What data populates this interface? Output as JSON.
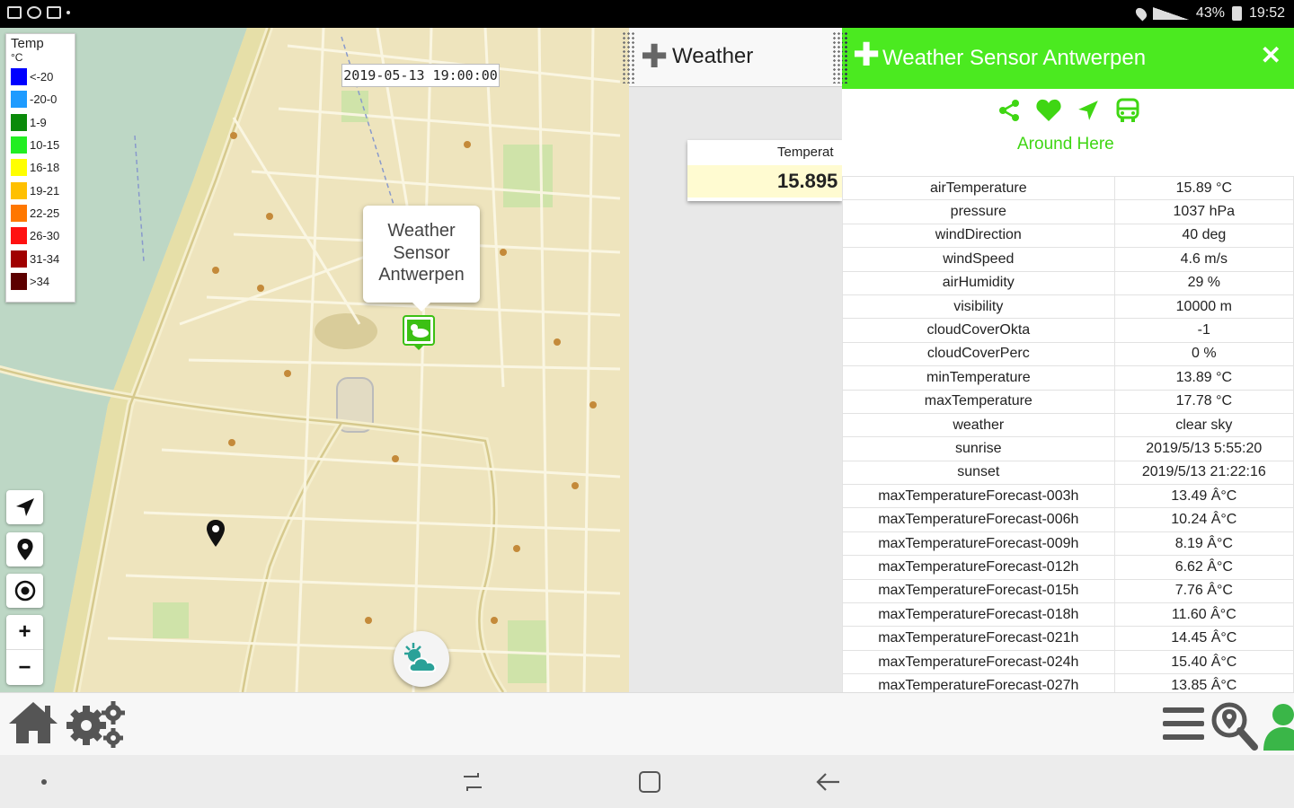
{
  "status_bar": {
    "battery": "43%",
    "time": "19:52"
  },
  "map": {
    "legend": {
      "title": "Temp",
      "unit": "°C",
      "items": [
        {
          "label": "<-20",
          "color": "#0000ff"
        },
        {
          "label": "-20-0",
          "color": "#1e9bff"
        },
        {
          "label": "1-9",
          "color": "#0a8a0a"
        },
        {
          "label": "10-15",
          "color": "#22ee22"
        },
        {
          "label": "16-18",
          "color": "#ffff00"
        },
        {
          "label": "19-21",
          "color": "#ffc000"
        },
        {
          "label": "22-25",
          "color": "#ff7700"
        },
        {
          "label": "26-30",
          "color": "#ff1111"
        },
        {
          "label": "31-34",
          "color": "#a00000"
        },
        {
          "label": ">34",
          "color": "#5c0000"
        }
      ]
    },
    "timestamp": "2019-05-13 19:00:00",
    "popup": {
      "line1": "Weather",
      "line2": "Sensor",
      "line3": "Antwerpen"
    },
    "zoom_in": "+",
    "zoom_out": "−"
  },
  "middle_panel": {
    "tab_label": "Weather",
    "card_label": "Temperat",
    "card_value": "15.895"
  },
  "detail_panel": {
    "title": "Weather Sensor Antwerpen",
    "close": "✕",
    "around_here": "Around Here",
    "accent_color": "#4bea20",
    "rows": [
      {
        "key": "airTemperature",
        "value": "15.89 °C"
      },
      {
        "key": "pressure",
        "value": "1037 hPa"
      },
      {
        "key": "windDirection",
        "value": "40 deg"
      },
      {
        "key": "windSpeed",
        "value": "4.6 m/s"
      },
      {
        "key": "airHumidity",
        "value": "29 %"
      },
      {
        "key": "visibility",
        "value": "10000 m"
      },
      {
        "key": "cloudCoverOkta",
        "value": "-1"
      },
      {
        "key": "cloudCoverPerc",
        "value": "0 %"
      },
      {
        "key": "minTemperature",
        "value": "13.89 °C"
      },
      {
        "key": "maxTemperature",
        "value": "17.78 °C"
      },
      {
        "key": "weather",
        "value": "clear sky"
      },
      {
        "key": "sunrise",
        "value": "2019/5/13 5:55:20"
      },
      {
        "key": "sunset",
        "value": "2019/5/13 21:22:16"
      },
      {
        "key": "maxTemperatureForecast-003h",
        "value": "13.49 Â°C"
      },
      {
        "key": "maxTemperatureForecast-006h",
        "value": "10.24 Â°C"
      },
      {
        "key": "maxTemperatureForecast-009h",
        "value": "8.19 Â°C"
      },
      {
        "key": "maxTemperatureForecast-012h",
        "value": "6.62 Â°C"
      },
      {
        "key": "maxTemperatureForecast-015h",
        "value": "7.76 Â°C"
      },
      {
        "key": "maxTemperatureForecast-018h",
        "value": "11.60 Â°C"
      },
      {
        "key": "maxTemperatureForecast-021h",
        "value": "14.45 Â°C"
      },
      {
        "key": "maxTemperatureForecast-024h",
        "value": "15.40 Â°C"
      },
      {
        "key": "maxTemperatureForecast-027h",
        "value": "13.85 Â°C"
      }
    ]
  },
  "icons": [
    "home-icon",
    "settings-icon",
    "menu-icon",
    "search-map-icon",
    "user-icon",
    "share-icon",
    "heart-icon",
    "navigate-icon",
    "bus-icon"
  ]
}
